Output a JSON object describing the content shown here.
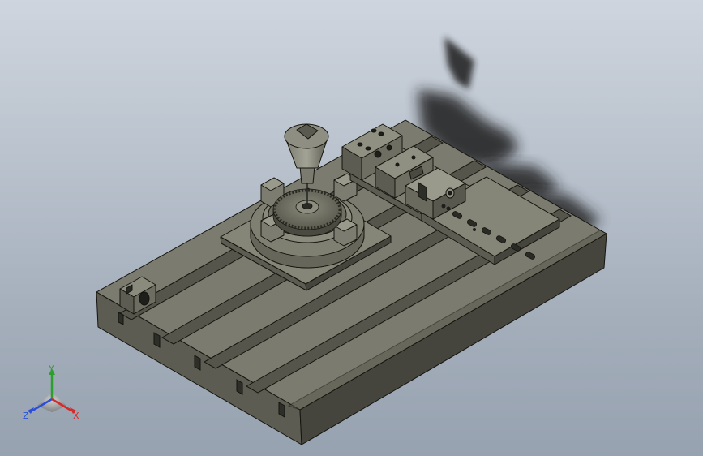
{
  "viewport": {
    "background_top": "#cfd5de",
    "background_bottom": "#97a2b0",
    "model_color": "#6e6e62",
    "model_face_top": "#7d7d70",
    "model_face_side": "#55554b",
    "model_face_dark": "#3f3f37",
    "edge_color": "#15150f",
    "shadow_color": "#1e1e1e"
  },
  "triad": {
    "x_label": "X",
    "y_label": "Y",
    "z_label": "Z",
    "x_color": "#d42a2a",
    "y_color": "#2ca02c",
    "z_color": "#2a4fd4"
  }
}
